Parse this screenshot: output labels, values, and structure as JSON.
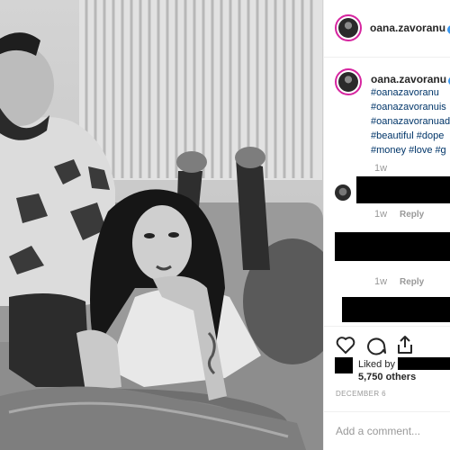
{
  "post": {
    "username": "oana.zavoranu",
    "verified_badge": "✓",
    "photo_alt": "Black and white photo of a man and a woman lying on a couch"
  },
  "caption": {
    "username": "oana.zavoranu",
    "hashtags": [
      "#oanazavoranu",
      "#oanazavoranuis",
      "#oanazavoranuad",
      "#beautiful #dope"
    ],
    "last_line_tags": [
      "#money",
      "#love",
      "#g"
    ],
    "time": "1w"
  },
  "comments": [
    {
      "time": "1w",
      "reply_label": "Reply"
    },
    {
      "time": "1w",
      "reply_label": "Reply"
    }
  ],
  "actions": {
    "like_icon": "heart-icon",
    "comment_icon": "comment-bubble-icon",
    "share_icon": "share-icon"
  },
  "likes": {
    "liked_by_label": "Liked by",
    "count_text": "5,750 others"
  },
  "date_label": "DECEMBER 6",
  "add_comment": {
    "placeholder": "Add a comment..."
  },
  "colors": {
    "verified": "#3897f0",
    "hashtag": "#003569",
    "meta": "#999999",
    "avatar_ring": "#d6249f"
  }
}
